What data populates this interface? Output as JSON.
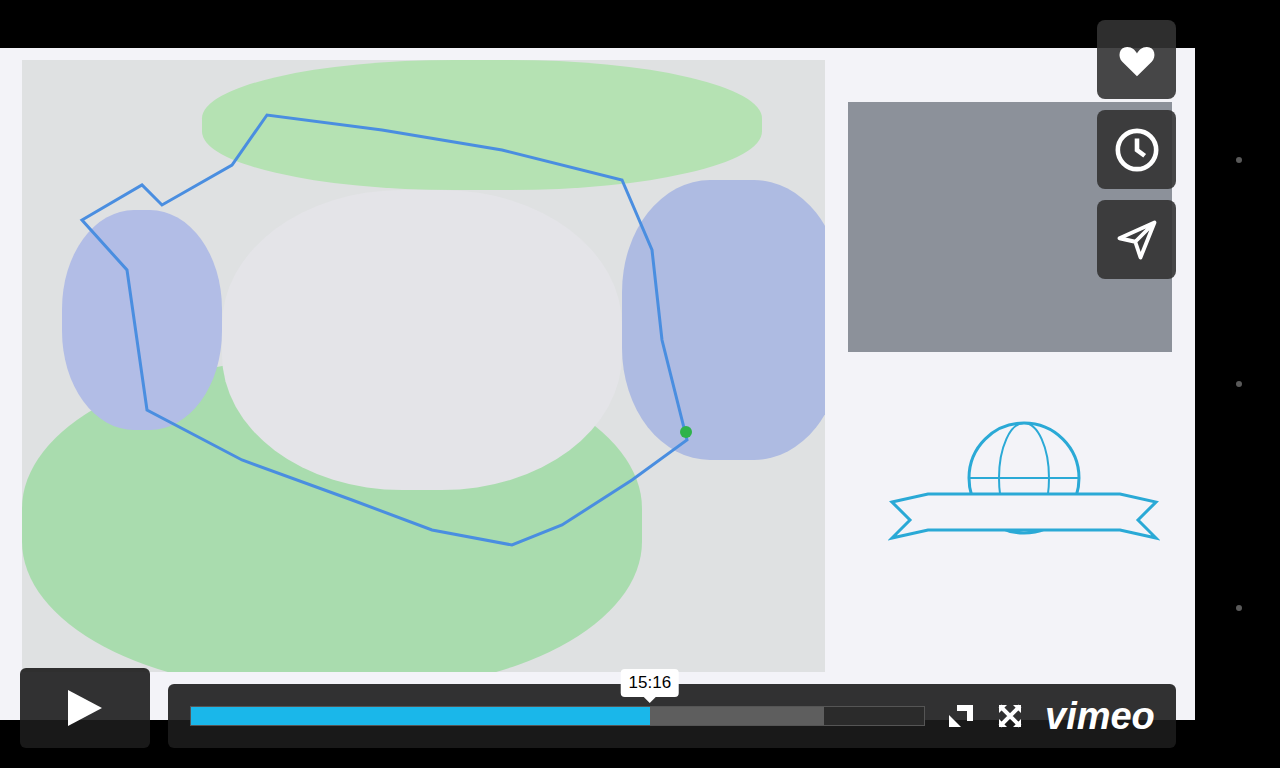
{
  "player": {
    "progress": {
      "tooltip": "15:16",
      "level": 0.626,
      "loaded": 0.864
    },
    "logo": "vimeo"
  }
}
